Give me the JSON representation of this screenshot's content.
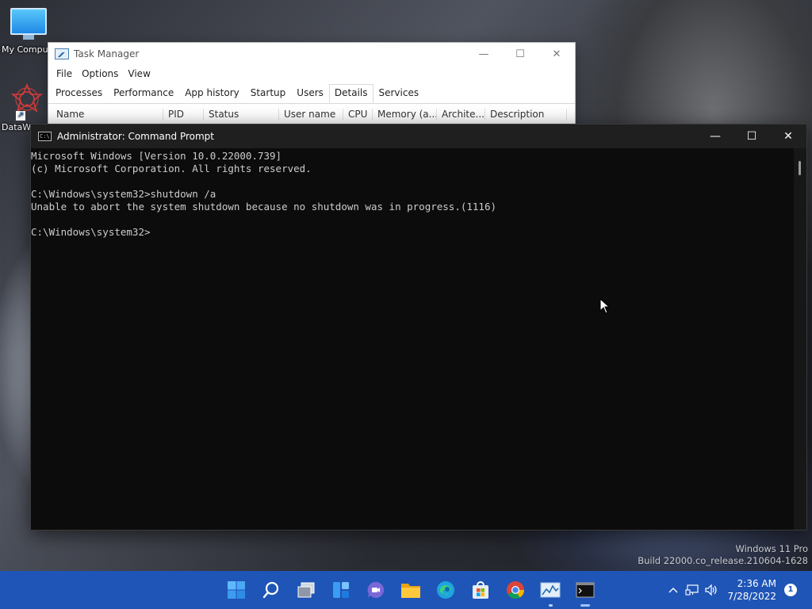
{
  "desktop": {
    "icons": [
      {
        "label": "My Compu"
      },
      {
        "label": "DataW"
      }
    ],
    "watermark": {
      "line1": "Windows 11 Pro",
      "line2": "Build 22000.co_release.210604-1628"
    }
  },
  "task_manager": {
    "title": "Task Manager",
    "menu": [
      "File",
      "Options",
      "View"
    ],
    "tabs": [
      "Processes",
      "Performance",
      "App history",
      "Startup",
      "Users",
      "Details",
      "Services"
    ],
    "active_tab": "Details",
    "columns": [
      "Name",
      "PID",
      "Status",
      "User name",
      "CPU",
      "Memory (a...",
      "Archite...",
      "Description"
    ],
    "controls": {
      "minimize": "—",
      "maximize": "☐",
      "close": "✕"
    }
  },
  "cmd": {
    "title": "Administrator: Command Prompt",
    "icon_text": "C:\\",
    "lines": [
      "Microsoft Windows [Version 10.0.22000.739]",
      "(c) Microsoft Corporation. All rights reserved.",
      "",
      "C:\\Windows\\system32>shutdown /a",
      "Unable to abort the system shutdown because no shutdown was in progress.(1116)",
      "",
      "C:\\Windows\\system32>"
    ],
    "controls": {
      "minimize": "—",
      "maximize": "☐",
      "close": "✕"
    }
  },
  "taskbar": {
    "apps": [
      {
        "name": "start-icon"
      },
      {
        "name": "search-icon"
      },
      {
        "name": "task-view-icon"
      },
      {
        "name": "widgets-icon"
      },
      {
        "name": "teams-chat-icon"
      },
      {
        "name": "file-explorer-icon"
      },
      {
        "name": "edge-icon"
      },
      {
        "name": "microsoft-store-icon"
      },
      {
        "name": "chrome-icon"
      },
      {
        "name": "task-manager-icon"
      },
      {
        "name": "command-prompt-icon"
      }
    ],
    "clock": {
      "time": "2:36 AM",
      "date": "7/28/2022"
    },
    "notification_count": "1",
    "accent": "#1f55b6"
  }
}
